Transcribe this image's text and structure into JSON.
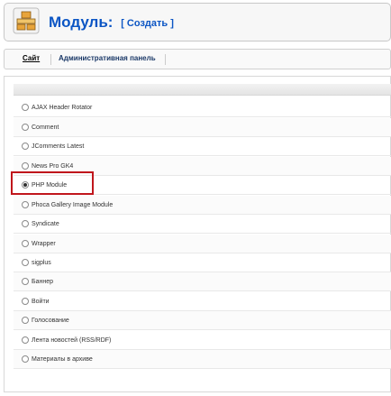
{
  "header": {
    "title": "Модуль:",
    "action": "[ Создать ]",
    "icon": "module-icon",
    "title_color": "#0b55c4"
  },
  "tabs": [
    {
      "label": "Сайт",
      "selected": true
    },
    {
      "label": "Административная панель",
      "selected": false
    }
  ],
  "modules": [
    {
      "label": "AJAX Header Rotator",
      "checked": false
    },
    {
      "label": "Comment",
      "checked": false
    },
    {
      "label": "JComments Latest",
      "checked": false
    },
    {
      "label": "News Pro GK4",
      "checked": false
    },
    {
      "label": "PHP Module",
      "checked": true
    },
    {
      "label": "Phoca Gallery Image Module",
      "checked": false
    },
    {
      "label": "Syndicate",
      "checked": false
    },
    {
      "label": "Wrapper",
      "checked": false
    },
    {
      "label": "sigplus",
      "checked": false
    },
    {
      "label": "Баннер",
      "checked": false
    },
    {
      "label": "Войти",
      "checked": false
    },
    {
      "label": "Голосование",
      "checked": false
    },
    {
      "label": "Лента новостей (RSS/RDF)",
      "checked": false
    },
    {
      "label": "Материалы в архиве",
      "checked": false
    }
  ],
  "highlight_color": "#c0161c"
}
